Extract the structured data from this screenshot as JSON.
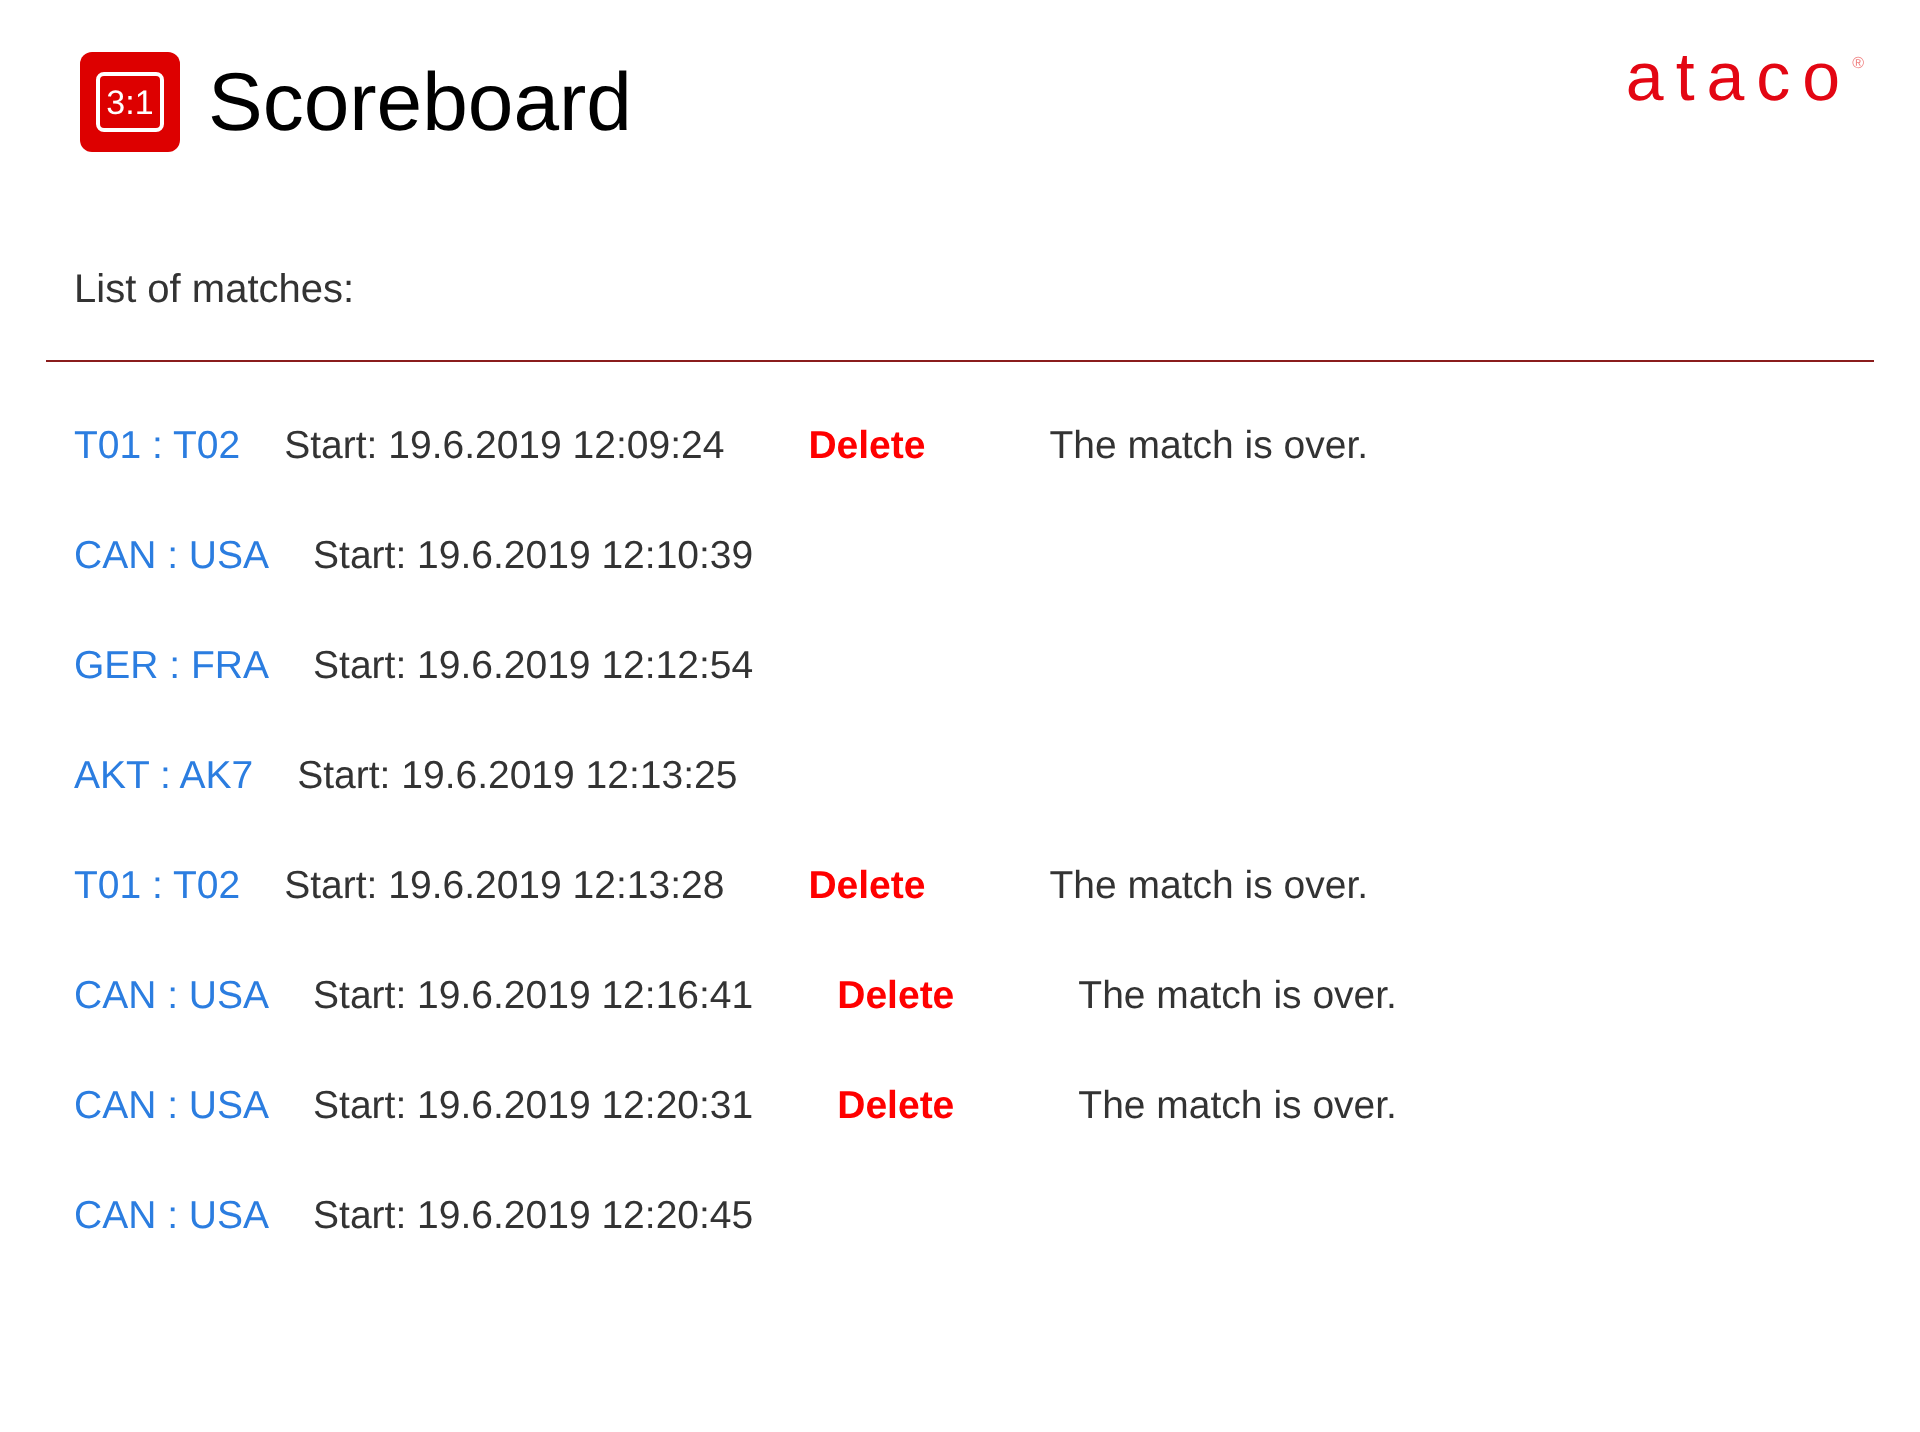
{
  "header": {
    "logo_text": "3:1",
    "title": "Scoreboard",
    "brand": {
      "name": "ataco",
      "mark": "®"
    }
  },
  "list_title": "List of matches:",
  "matches": [
    {
      "teams": "T01 : T02",
      "start": "Start: 19.6.2019 12:09:24",
      "delete": "Delete",
      "status": "The match is over."
    },
    {
      "teams": "CAN : USA",
      "start": "Start: 19.6.2019 12:10:39"
    },
    {
      "teams": "GER : FRA",
      "start": "Start: 19.6.2019 12:12:54"
    },
    {
      "teams": "AKT : AK7",
      "start": "Start: 19.6.2019 12:13:25"
    },
    {
      "teams": "T01 : T02",
      "start": "Start: 19.6.2019 12:13:28",
      "delete": "Delete",
      "status": "The match is over."
    },
    {
      "teams": "CAN : USA",
      "start": "Start: 19.6.2019 12:16:41",
      "delete": "Delete",
      "status": "The match is over."
    },
    {
      "teams": "CAN : USA",
      "start": "Start: 19.6.2019 12:20:31",
      "delete": "Delete",
      "status": "The match is over."
    },
    {
      "teams": "CAN : USA",
      "start": "Start: 19.6.2019 12:20:45"
    }
  ]
}
